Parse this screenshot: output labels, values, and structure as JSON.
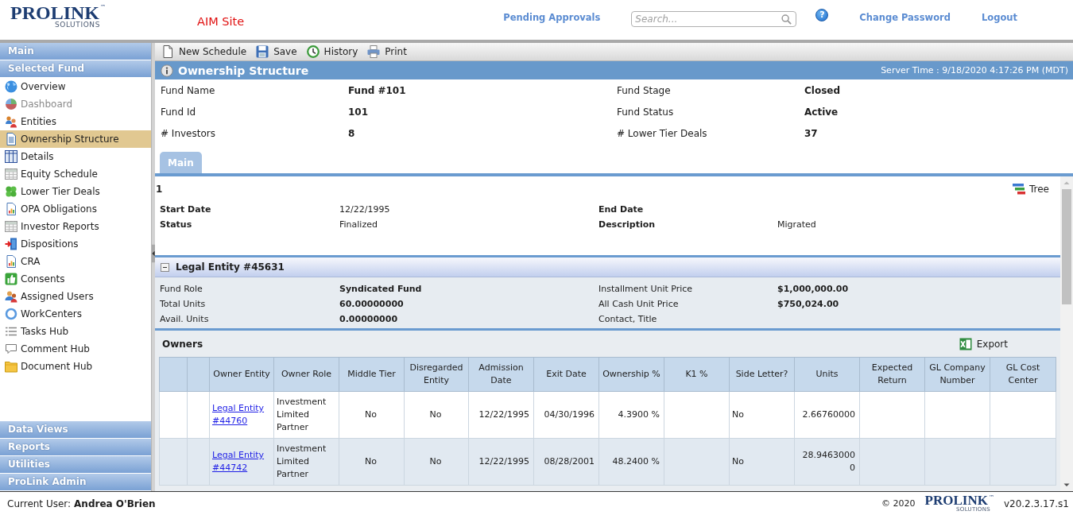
{
  "header": {
    "logo": {
      "name": "PROLINK",
      "tagline": "SOLUTIONS",
      "trademark": "™"
    },
    "site": "AIM Site",
    "pending_link": "Pending Approvals",
    "search": {
      "placeholder": "Search..."
    },
    "help_button": "?",
    "account_links": [
      "Change Password",
      "Logout"
    ]
  },
  "sidebar": {
    "sections": [
      {
        "title": "Main"
      },
      {
        "title": "Selected Fund",
        "items": [
          {
            "label": "Overview",
            "selected": false,
            "disabled": false
          },
          {
            "label": "Dashboard",
            "selected": false,
            "disabled": true
          },
          {
            "label": "Entities",
            "selected": false,
            "disabled": false
          },
          {
            "label": "Ownership Structure",
            "selected": true,
            "disabled": false
          },
          {
            "label": "Details",
            "selected": false,
            "disabled": false
          },
          {
            "label": "Equity Schedule",
            "selected": false,
            "disabled": false
          },
          {
            "label": "Lower Tier Deals",
            "selected": false,
            "disabled": false
          },
          {
            "label": "OPA Obligations",
            "selected": false,
            "disabled": false
          },
          {
            "label": "Investor Reports",
            "selected": false,
            "disabled": false
          },
          {
            "label": "Dispositions",
            "selected": false,
            "disabled": false
          },
          {
            "label": "CRA",
            "selected": false,
            "disabled": false
          },
          {
            "label": "Consents",
            "selected": false,
            "disabled": false
          },
          {
            "label": "Assigned Users",
            "selected": false,
            "disabled": false
          },
          {
            "label": "WorkCenters",
            "selected": false,
            "disabled": false
          },
          {
            "label": "Tasks Hub",
            "selected": false,
            "disabled": false
          },
          {
            "label": "Comment Hub",
            "selected": false,
            "disabled": false
          },
          {
            "label": "Document Hub",
            "selected": false,
            "disabled": false
          }
        ]
      },
      {
        "title": "Data Views"
      },
      {
        "title": "Reports"
      },
      {
        "title": "Utilities"
      },
      {
        "title": "ProLink Admin"
      }
    ]
  },
  "toolbar": [
    "New Schedule",
    "Save",
    "History",
    "Print"
  ],
  "page_header": {
    "title": "Ownership Structure",
    "server_time": "Server Time : 9/18/2020 4:17:26 PM (MDT)"
  },
  "fund_info": [
    {
      "label": "Fund Name",
      "value": "Fund #101"
    },
    {
      "label": "Fund Stage",
      "value": "Closed"
    },
    {
      "label": "Fund Id",
      "value": "101"
    },
    {
      "label": "Fund Status",
      "value": "Active"
    },
    {
      "label": "# Investors",
      "value": "8"
    },
    {
      "label": "# Lower Tier Deals",
      "value": "37"
    }
  ],
  "tabs": [
    {
      "label": "Main",
      "selected": true
    }
  ],
  "schedule": {
    "number": "1",
    "tree_button": "Tree",
    "fields": [
      {
        "label": "Start Date",
        "value": "12/22/1995"
      },
      {
        "label": "End Date"
      },
      {
        "label": "Status",
        "value": "Finalized"
      },
      {
        "label": "Description",
        "value": "Migrated"
      }
    ]
  },
  "legal_entity": {
    "title": "Legal Entity #45631",
    "expanded": true,
    "fields": [
      {
        "label": "Fund Role",
        "value": "Syndicated Fund"
      },
      {
        "label": "Installment Unit Price",
        "value": "$1,000,000.00"
      },
      {
        "label": "Total Units",
        "value": "60.00000000"
      },
      {
        "label": "All Cash Unit Price",
        "value": "$750,024.00"
      },
      {
        "label": "Avail. Units",
        "value": "0.00000000"
      },
      {
        "label": "Contact, Title"
      }
    ]
  },
  "owners": {
    "title": "Owners",
    "export_button": "Export",
    "columns": [
      "Owner Entity",
      "Owner Role",
      "Middle Tier",
      "Disregarded Entity",
      "Admission Date",
      "Exit Date",
      "Ownership %",
      "K1 %",
      "Side Letter?",
      "Units",
      "Expected Return",
      "GL Company Number",
      "GL Cost Center"
    ],
    "rows": [
      {
        "owner_entity": "Legal Entity #44760",
        "owner_role": "Investment Limited Partner",
        "middle_tier": "No",
        "disregarded_entity": "No",
        "admission_date": "12/22/1995",
        "exit_date": "04/30/1996",
        "ownership": "4.3900 %",
        "side_letter": "No",
        "units": "2.66760000"
      },
      {
        "owner_entity": "Legal Entity #44742",
        "owner_role": "Investment Limited Partner",
        "middle_tier": "No",
        "disregarded_entity": "No",
        "admission_date": "12/22/1995",
        "exit_date": "08/28/2001",
        "ownership": "48.2400 %",
        "side_letter": "No",
        "units": "28.94630000"
      }
    ]
  },
  "footer": {
    "user_label": "Current User:",
    "user_name": "Andrea O'Brien",
    "copyright": "© 2020",
    "logo": {
      "name": "PROLINK",
      "tagline": "SOLUTIONS",
      "trademark": "™"
    },
    "version": "v20.2.3.17.s1"
  }
}
